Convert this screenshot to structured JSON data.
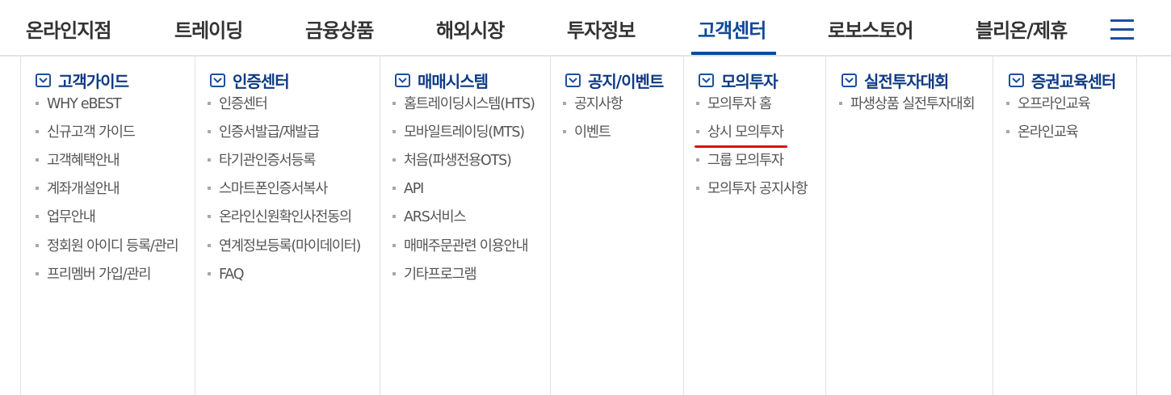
{
  "nav": {
    "items": [
      {
        "label": "온라인지점"
      },
      {
        "label": "트레이딩"
      },
      {
        "label": "금융상품"
      },
      {
        "label": "해외시장"
      },
      {
        "label": "투자정보"
      },
      {
        "label": "고객센터",
        "active": true
      },
      {
        "label": "로보스토어"
      },
      {
        "label": "블리온/제휴"
      }
    ],
    "menu_icon": "hamburger-menu-icon"
  },
  "columns": [
    {
      "heading": "고객가이드",
      "items": [
        "WHY eBEST",
        "신규고객 가이드",
        "고객혜택안내",
        "계좌개설안내",
        "업무안내",
        "정회원 아이디 등록/관리",
        "프리멤버 가입/관리"
      ]
    },
    {
      "heading": "인증센터",
      "items": [
        "인증센터",
        "인증서발급/재발급",
        "타기관인증서등록",
        "스마트폰인증서복사",
        "온라인신원확인사전동의",
        "연계정보등록(마이데이터)",
        "FAQ"
      ]
    },
    {
      "heading": "매매시스템",
      "items": [
        "홈트레이딩시스템(HTS)",
        "모바일트레이딩(MTS)",
        "처음(파생전용OTS)",
        "API",
        "ARS서비스",
        "매매주문관련 이용안내",
        "기타프로그램"
      ]
    },
    {
      "heading": "공지/이벤트",
      "items": [
        "공지사항",
        "이벤트"
      ]
    },
    {
      "heading": "모의투자",
      "items": [
        "모의투자 홈",
        "상시 모의투자",
        "그룹 모의투자",
        "모의투자 공지사항"
      ]
    },
    {
      "heading": "실전투자대회",
      "items": [
        "파생상품 실전투자대회"
      ]
    },
    {
      "heading": "증권교육센터",
      "items": [
        "오프라인교육",
        "온라인교육"
      ]
    }
  ],
  "colors": {
    "active_nav": "#0c4a9c",
    "column_heading": "#0f3a85",
    "highlight_underline": "#dd1111",
    "divider": "#e1e1e1"
  },
  "highlighted_item": "상시 모의투자"
}
